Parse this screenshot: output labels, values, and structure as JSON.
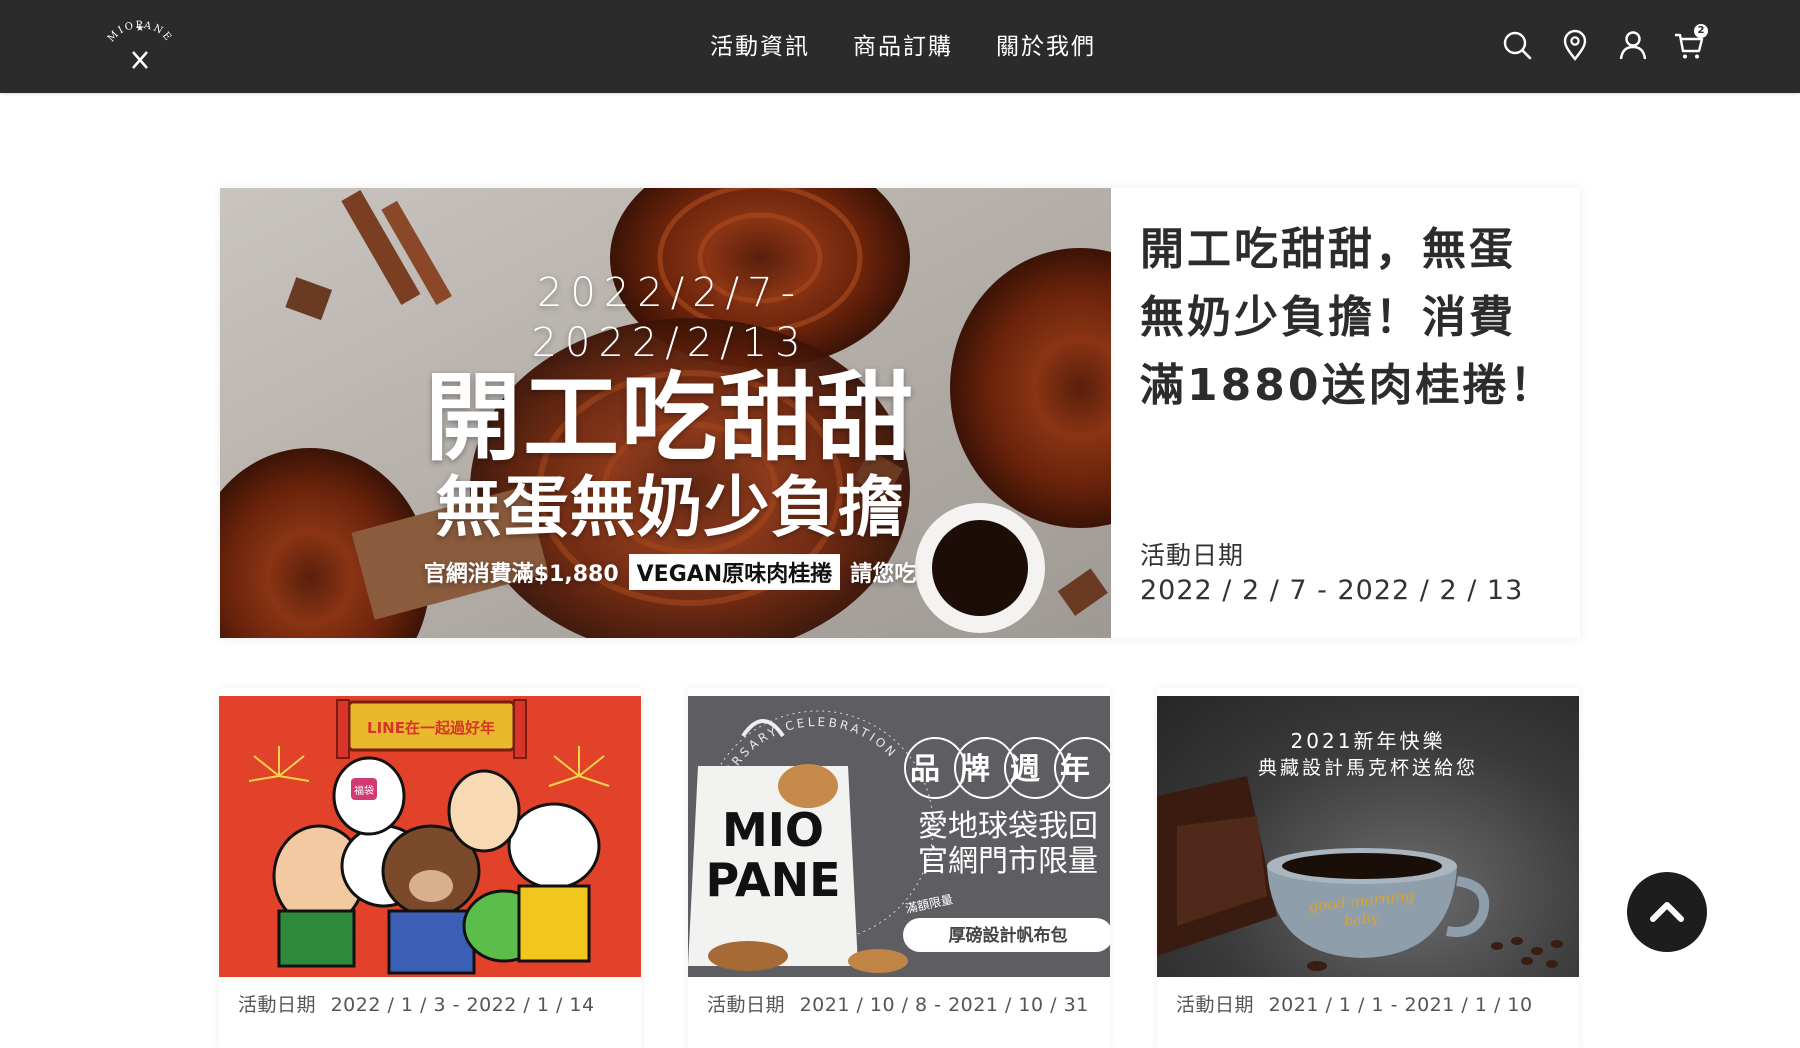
{
  "header": {
    "logo_text": "MIOPANE",
    "nav": [
      {
        "label": "活動資訊"
      },
      {
        "label": "商品訂購"
      },
      {
        "label": "關於我們"
      }
    ],
    "icons": [
      "search-icon",
      "location-pin-icon",
      "user-icon",
      "cart-icon"
    ],
    "cart_count": "2",
    "bg_color": "#2b2b2b"
  },
  "featured": {
    "banner": {
      "date": "2022/2/7-2022/2/13",
      "title": "開工吃甜甜",
      "subtitle": "無蛋無奶少負擔",
      "promo_prefix": "官網消費滿$1,880",
      "promo_tag": "VEGAN原味肉桂捲",
      "promo_suffix": "請您吃"
    },
    "title": "開工吃甜甜，無蛋無奶少負擔！消費滿1880送肉桂捲！",
    "date_label": "活動日期",
    "date": "2022 / 2 / 7 - 2022 / 2 / 13"
  },
  "cards": [
    {
      "banner_text": "LINE在一起過好年",
      "badge_text": "福袋",
      "date_label": "活動日期",
      "date": "2022 / 1 / 3 - 2022 / 1 / 14"
    },
    {
      "banner_title": "品牌週年",
      "banner_line1": "愛地球袋我回",
      "banner_line2": "官網門市限量",
      "tag_small": "滿額限量",
      "tag_main": "厚磅設計帆布包",
      "bag_line1": "MIO",
      "bag_line2": "PANE",
      "ring_text": "ANNIVERSARY CELEBRATION",
      "date_label": "活動日期",
      "date": "2021 / 10 / 8 - 2021 / 10 / 31"
    },
    {
      "banner_line1": "2021新年快樂",
      "banner_line2": "典藏設計馬克杯送給您",
      "mug_text1": "good morning",
      "mug_text2": "baby",
      "date_label": "活動日期",
      "date": "2021 / 1 / 1 - 2021 / 1 / 10"
    }
  ],
  "back_to_top": "chevron-up-icon"
}
